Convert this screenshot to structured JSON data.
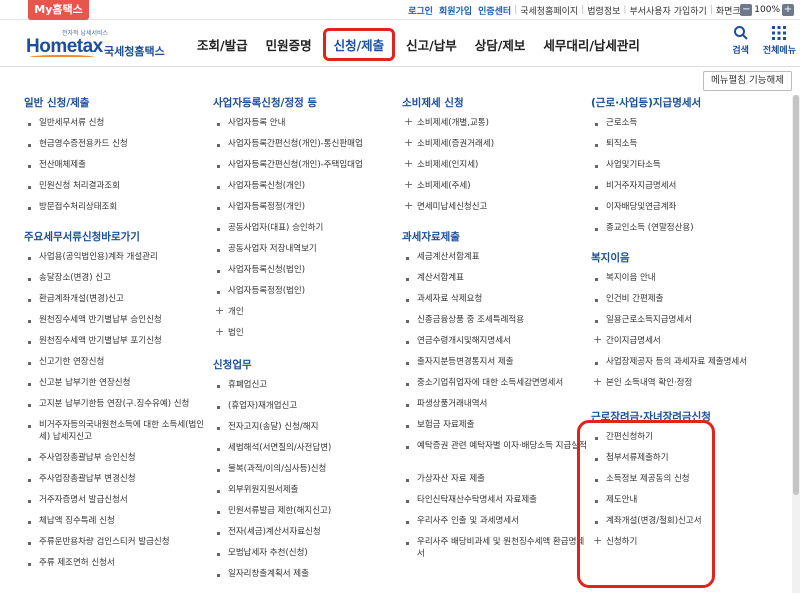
{
  "topbar": {
    "my_tab": "My홈택스",
    "links": [
      "로그인",
      "회원가입",
      "인증센터",
      "국세청홈페이지",
      "법령정보",
      "부서사용자 가입하기",
      "화면크기"
    ],
    "zoom_minus": "−",
    "zoom_value": "100%",
    "zoom_plus": "+"
  },
  "header": {
    "logo_small": "전자적 납세서비스",
    "logo_text": "Hometax",
    "logo_korean": "국세청홈택스",
    "nav": [
      "조회/발급",
      "민원증명",
      "신청/제출",
      "신고/납부",
      "상담/제보",
      "세무대리/납세관리"
    ],
    "search_label": "검색",
    "allmenu_label": "전체메뉴"
  },
  "toggle_button": "메뉴펼침 기능해제",
  "columns": [
    {
      "sections": [
        {
          "title": "일반 신청/제출",
          "items": [
            {
              "label": "일반세무서류 신청"
            },
            {
              "label": "현금영수증전용카드 신청"
            },
            {
              "label": "전산매체제출"
            },
            {
              "label": "민원신청 처리결과조회"
            },
            {
              "label": "방문접수처리상태조회"
            }
          ]
        },
        {
          "title": "주요세무서류신청바로가기",
          "items": [
            {
              "label": "사업용(공익법인용)계좌 개설관리"
            },
            {
              "label": "송달장소(변경) 신고"
            },
            {
              "label": "환급계좌개설(변경)신고"
            },
            {
              "label": "원천징수세액 반기별납부 승인신청"
            },
            {
              "label": "원천징수세액 반기별납부 포기신청"
            },
            {
              "label": "신고기한 연장신청"
            },
            {
              "label": "신고분 납부기한 연장신청"
            },
            {
              "label": "고지분 납부기한등 연장(구.징수유예) 신청"
            },
            {
              "label": "비거주자등의국내원천소득에 대한 소득세(법인세) 납세지신고",
              "wrap": true
            },
            {
              "label": "주사업장총괄납부 승인신청"
            },
            {
              "label": "주사업장총괄납부 변경신청"
            },
            {
              "label": "거주자증명서 발급신청서"
            },
            {
              "label": "체납액 징수특례 신청"
            },
            {
              "label": "주류운반용차량 검인스티커 발급신청"
            },
            {
              "label": "주류 제조면허 신청서"
            }
          ]
        }
      ]
    },
    {
      "sections": [
        {
          "title": "사업자등록신청/정정 등",
          "items": [
            {
              "label": "사업자등록 안내"
            },
            {
              "label": "사업자등록간편신청(개인)-통신판매업"
            },
            {
              "label": "사업자등록간편신청(개인)-주택임대업"
            },
            {
              "label": "사업자등록신청(개인)"
            },
            {
              "label": "사업자등록정정(개인)"
            },
            {
              "label": "공동사업자(대표) 승인하기"
            },
            {
              "label": "공동사업자 저장내역보기"
            },
            {
              "label": "사업자등록신청(법인)"
            },
            {
              "label": "사업자등록정정(법인)"
            },
            {
              "label": "개인",
              "plus": true
            },
            {
              "label": "법인",
              "plus": true
            }
          ]
        },
        {
          "title": "신청업무",
          "items": [
            {
              "label": "휴폐업신고"
            },
            {
              "label": "(휴업자)재개업신고"
            },
            {
              "label": "전자고지(송달) 신청/해지"
            },
            {
              "label": "세법해석(서면질의/사전답변)"
            },
            {
              "label": "불복(과적/이의/심사등)신청"
            },
            {
              "label": "외부위원지원서제출"
            },
            {
              "label": "민원서류발급 제한(해지신고)"
            },
            {
              "label": "전자(세금)계산서자료신청"
            },
            {
              "label": "모범납세자 추천(신청)"
            },
            {
              "label": "일자리창출계획서 제출"
            }
          ]
        }
      ]
    },
    {
      "sections": [
        {
          "title": "소비제세 신청",
          "items": [
            {
              "label": "소비제세(개별,교통)",
              "plus": true
            },
            {
              "label": "소비제세(증권거래세)",
              "plus": true
            },
            {
              "label": "소비제세(인지세)",
              "plus": true
            },
            {
              "label": "소비제세(주세)",
              "plus": true
            },
            {
              "label": "면세미납세신청신고",
              "plus": true
            }
          ]
        },
        {
          "title": "과세자료제출",
          "items": [
            {
              "label": "세금계산서합계표"
            },
            {
              "label": "계산서합계표"
            },
            {
              "label": "과세자료 삭제요청"
            },
            {
              "label": "신종금융상품 중 조세특례적용"
            },
            {
              "label": "연금수령개시및해지명세서"
            },
            {
              "label": "출자지분등변경통지서 제출"
            },
            {
              "label": "중소기업취업자에 대한 소득세감면명세서"
            },
            {
              "label": "파생상품거래내역서"
            },
            {
              "label": "보험금 자료제출"
            },
            {
              "label": "예탁증권 관련 예탁자별 이자·배당소득 지급실적",
              "wrap": true
            },
            {
              "label": "가상자산 자료 제출"
            },
            {
              "label": "타인신탁재산수탁명세서 자료제출"
            },
            {
              "label": "우리사주 인출 및 과세명세서"
            },
            {
              "label": "우리사주 배당비과세 및 원천징수세액 환급명세서",
              "wrap": true
            }
          ]
        }
      ]
    },
    {
      "sections": [
        {
          "title": "(근로·사업등)지급명세서",
          "items": [
            {
              "label": "근로소득"
            },
            {
              "label": "퇴직소득"
            },
            {
              "label": "사업및기타소득"
            },
            {
              "label": "비거주자지급명세서"
            },
            {
              "label": "이자배당및연금계좌"
            },
            {
              "label": "종교인소득 (연말정산용)"
            }
          ]
        },
        {
          "title": "복지이음",
          "items": [
            {
              "label": "복지이음 안내"
            },
            {
              "label": "인건비 간편제출"
            },
            {
              "label": "일용근로소득지급명세서"
            },
            {
              "label": "간이지급명세서",
              "plus": true
            },
            {
              "label": "사업장제공자 등의 과세자료 제출명세서"
            },
            {
              "label": "본인 소득내역 확인·정정",
              "plus": true
            }
          ]
        },
        {
          "title": "근로장려금·자녀장려금신청",
          "items": [
            {
              "label": "간편신청하기"
            },
            {
              "label": "첨부서류제출하기"
            },
            {
              "label": "소득정보 제공동의 신청"
            },
            {
              "label": "제도안내"
            },
            {
              "label": "계좌개설(변경/철회)신고서"
            },
            {
              "label": "신청하기",
              "plus": true
            }
          ]
        }
      ]
    }
  ]
}
